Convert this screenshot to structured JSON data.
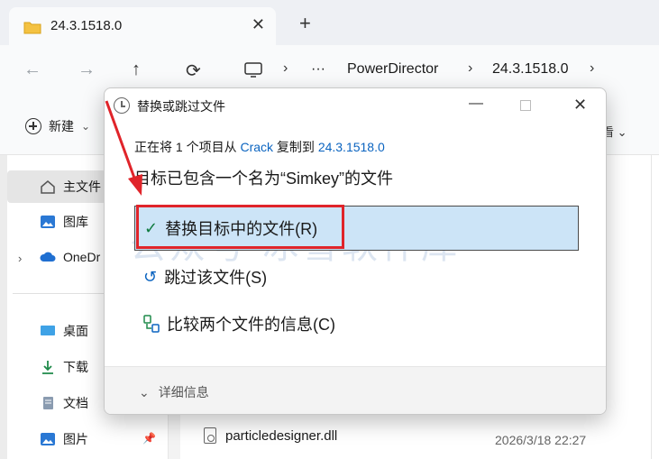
{
  "window": {
    "tab_title": "24.3.1518.0",
    "tab_close": "✕",
    "tab_new": "+"
  },
  "navigation": {
    "back": "←",
    "forward": "→",
    "up": "↑",
    "refresh": "⟳",
    "more": "···",
    "crumbs": [
      "PowerDirector",
      "24.3.1518.0"
    ],
    "separator": "›"
  },
  "toolbar": {
    "new_label": "新建",
    "new_chevron": "⌄",
    "right_fragment": "看 ⌄"
  },
  "sidebar": {
    "items": [
      {
        "label": "主文件",
        "icon": "home-icon"
      },
      {
        "label": "图库",
        "icon": "gallery-icon"
      },
      {
        "label": "OneDr",
        "icon": "cloud-icon"
      },
      {
        "label": "桌面",
        "icon": "desktop-icon"
      },
      {
        "label": "下载",
        "icon": "download-icon"
      },
      {
        "label": "文档",
        "icon": "document-icon"
      },
      {
        "label": "图片",
        "icon": "pictures-icon"
      }
    ],
    "expand": "›",
    "pin": "📌"
  },
  "file_list": {
    "name": "particledesigner.dll",
    "date": "2026/3/18 22:27"
  },
  "dialog": {
    "title": "替换或跳过文件",
    "minimize": "—",
    "close": "✕",
    "line1_prefix": "正在将 1 个项目从 ",
    "source": "Crack",
    "line1_middle": " 复制到 ",
    "destination": "24.3.1518.0",
    "line2": "目标已包含一个名为“Simkey”的文件",
    "options": [
      {
        "label": "替换目标中的文件(R)",
        "icon": "check-icon"
      },
      {
        "label": "跳过该文件(S)",
        "icon": "skip-icon"
      },
      {
        "label": "比较两个文件的信息(C)",
        "icon": "compare-icon"
      }
    ],
    "details_chevron": "⌄",
    "details": "详细信息"
  },
  "watermark": "公众号 冰雪软件库",
  "colors": {
    "highlight_red": "#e0242a",
    "selection_blue": "#cce4f7",
    "link_blue": "#0b64c0"
  }
}
